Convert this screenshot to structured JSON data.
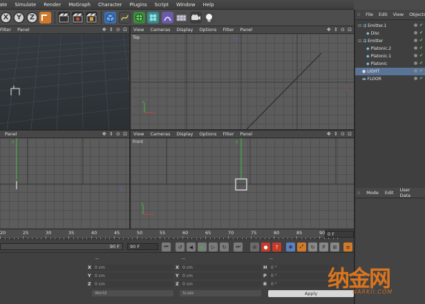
{
  "menubar": {
    "items": [
      "ate",
      "Simulate",
      "Render",
      "MoGraph",
      "Character",
      "Plugins",
      "Script",
      "Window",
      "Help"
    ]
  },
  "toolbar": {
    "axis_x": "X",
    "axis_y": "Y",
    "axis_z": "Z"
  },
  "viewports": {
    "perspective": {
      "menu": [
        "Filter",
        "Panel"
      ]
    },
    "top": {
      "menu": [
        "View",
        "Cameras",
        "Display",
        "Options",
        "Filter",
        "Panel"
      ],
      "label": "Top"
    },
    "right": {
      "menu": [
        "Panel"
      ]
    },
    "front": {
      "menu": [
        "View",
        "Cameras",
        "Display",
        "Options",
        "Filter",
        "Panel"
      ],
      "label": "Front"
    },
    "nav_icons": "✥ ⇕ ⊙ ⊡"
  },
  "object_manager": {
    "menu": [
      "File",
      "Edit",
      "View",
      "Objects"
    ],
    "objects": [
      {
        "name": "Emitter.1",
        "indent": 0,
        "selected": false
      },
      {
        "name": "Disc",
        "indent": 1,
        "selected": false
      },
      {
        "name": "Emitter",
        "indent": 0,
        "selected": false
      },
      {
        "name": "Platonic.2",
        "indent": 1,
        "selected": false
      },
      {
        "name": "Platonic.1",
        "indent": 1,
        "selected": false
      },
      {
        "name": "Platonic",
        "indent": 1,
        "selected": false
      },
      {
        "name": "LIGHT",
        "indent": 0,
        "selected": true
      },
      {
        "name": "FLOOR",
        "indent": 0,
        "selected": false
      }
    ]
  },
  "attribute_manager": {
    "menu": [
      "Mode",
      "Edit",
      "User Data"
    ]
  },
  "timeline": {
    "ticks": [
      "20",
      "25",
      "30",
      "35",
      "40",
      "45",
      "50",
      "55",
      "60",
      "65",
      "70",
      "75",
      "80",
      "85",
      "90"
    ],
    "current_frame": "0 F",
    "end_frame_left": "90 F",
    "end_frame_right": "90 F"
  },
  "coordinates": {
    "header_left": "--",
    "header_mid": "--",
    "header_right": "--",
    "pos": [
      {
        "axis": "X",
        "value": "0 cm"
      },
      {
        "axis": "Y",
        "value": "0 cm"
      },
      {
        "axis": "Z",
        "value": "0 cm"
      }
    ],
    "size": [
      {
        "axis": "X",
        "value": "0 cm"
      },
      {
        "axis": "Y",
        "value": "0 cm"
      },
      {
        "axis": "Z",
        "value": "0 cm"
      }
    ],
    "rot": [
      {
        "axis": "H",
        "value": "0 °"
      },
      {
        "axis": "P",
        "value": "0 °"
      },
      {
        "axis": "B",
        "value": "0 °"
      }
    ],
    "mode_left": "World",
    "mode_mid": "Scale",
    "apply_label": "Apply"
  },
  "watermark": {
    "text": "纳金网",
    "sub": "NARKII.COM"
  },
  "colors": {
    "selection": "#5a7497",
    "axis_x": "#d04040",
    "axis_y": "#40c040",
    "axis_z": "#4a6ad0",
    "play": "#3fae3f",
    "record": "#c83a2a",
    "watermark": "#e87a1c"
  }
}
